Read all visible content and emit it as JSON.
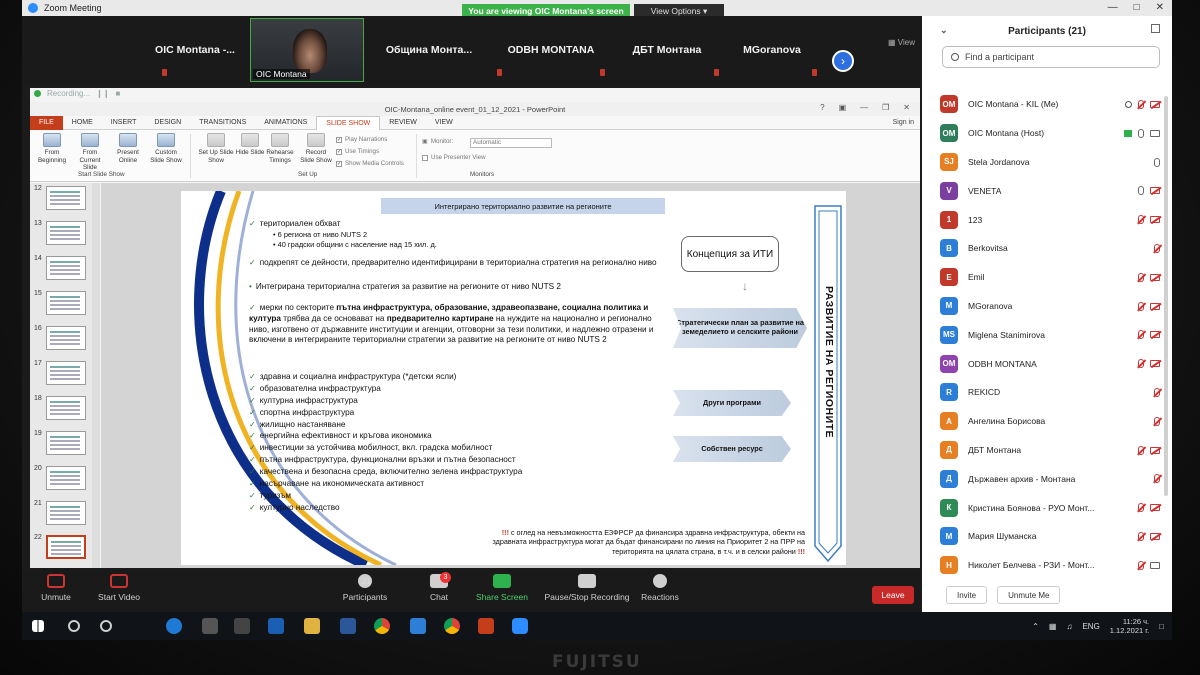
{
  "zoom": {
    "window_title": "Zoom Meeting",
    "viewing_banner": "You are viewing OIC Montana's screen",
    "view_options": "View Options",
    "gallery_view_label": "View",
    "gallery_tiles": [
      "OIC Montana -...",
      "OIC Montana",
      "Община  Монта...",
      "ODBH MONTANA",
      "ДБТ Монтана",
      "MGoranova"
    ],
    "recording_label": "Recording..."
  },
  "ppt": {
    "window_title": "OIC-Montana_online event_01_12_2021 - PowerPoint",
    "tabs": [
      "FILE",
      "HOME",
      "INSERT",
      "DESIGN",
      "TRANSITIONS",
      "ANIMATIONS",
      "SLIDE SHOW",
      "REVIEW",
      "VIEW"
    ],
    "sign_in": "Sign in",
    "ribbon": {
      "from_beginning": "From Beginning",
      "from_current": "From Current Slide",
      "present_online": "Present Online",
      "custom_show": "Custom Slide Show",
      "group_start": "Start Slide Show",
      "set_up": "Set Up Slide Show",
      "hide_slide": "Hide Slide",
      "rehearse": "Rehearse Timings",
      "record": "Record Slide Show",
      "play_narrations": "Play Narrations",
      "use_timings": "Use Timings",
      "show_media": "Show Media Controls",
      "group_setup": "Set Up",
      "monitor_label": "Monitor:",
      "monitor_value": "Automatic",
      "presenter_view": "Use Presenter View",
      "group_monitors": "Monitors"
    },
    "thumbnails": [
      "12",
      "13",
      "14",
      "15",
      "16",
      "17",
      "18",
      "19",
      "20",
      "21",
      "22"
    ]
  },
  "slide": {
    "title": "Интегрирано териториално развитие на регионите",
    "b1": "териториален обхват",
    "b1_sub1": "6 региона от ниво NUTS 2",
    "b1_sub2": "40 градски общини с население над 15 хил. д.",
    "b2": "подкрепят се дейности, предварително идентифицирани в териториална стратегия на регионално ниво",
    "b3": "Интегрирана териториална стратегия за развитие на регионите от ниво NUTS 2",
    "b4_pre": "мерки по секторите ",
    "b4_bold": "пътна инфраструктура, образование, здравеопазване, социална политика и култура",
    "b4_mid": " трябва да се основават на ",
    "b4_bold2": "предварително картиране",
    "b4_post": " на нуждите на национално и регионално ниво, изготвено от държавните институции и агенции, отговорни за тези политики, и надлежно отразени и включени в интегрираните териториални стратегии за развитие на регионите от ниво NUTS 2",
    "list": [
      "здравна и социална инфраструктура (*детски ясли)",
      "образователна инфраструктура",
      "културна инфраструктура",
      "спортна инфраструктура",
      "жилищно настаняване",
      "енергийна ефективност и кръгова икономика",
      "инвестиции за устойчива мобилност, вкл. градска мобилност",
      "пътна инфраструктура, функционални връзки и пътна безопасност",
      "качествена и безопасна среда, включително зелена инфраструктура",
      "насърчаване на икономическата активност",
      "туризъм",
      "културно наследство"
    ],
    "concept": "Концепция за ИТИ",
    "pill1": "Стратегически план за развитие на земеделието и селските райони",
    "pill2": "Други програми",
    "pill3": "Собствен ресурс",
    "vertical": "РАЗВИТИЕ НА РЕГИОНИТЕ",
    "note_marks": "!!!",
    "note_text": "с оглед на невъзможността ЕЗФРСР да финансира здравна инфраструктура, обекти на здравната инфраструктура могат да бъдат финансирани по линия на Приоритет 2 на ПРР на територията на цялата страна, в т.ч. и в селски райони",
    "note_end": "!!!"
  },
  "toolbar": {
    "unmute": "Unmute",
    "start_video": "Start Video",
    "participants": "Participants",
    "participants_count": "21",
    "chat": "Chat",
    "chat_badge": "3",
    "share_screen": "Share Screen",
    "pause_recording": "Pause/Stop Recording",
    "reactions": "Reactions",
    "leave": "Leave"
  },
  "panel": {
    "title": "Participants (21)",
    "search_placeholder": "Find a participant",
    "participants": [
      {
        "initials": "OM",
        "name": "OIC Montana - KIL (Me)",
        "color": "#c0392b"
      },
      {
        "initials": "OM",
        "name": "OIC Montana (Host)",
        "color": "#2e7d5b"
      },
      {
        "initials": "SJ",
        "name": "Stela Jordanova",
        "color": "#e67e22"
      },
      {
        "initials": "V",
        "name": "VENETA",
        "color": "#7b3fa0"
      },
      {
        "initials": "1",
        "name": "123",
        "color": "#c0392b"
      },
      {
        "initials": "B",
        "name": "Berkovitsa",
        "color": "#2d7ed6"
      },
      {
        "initials": "E",
        "name": "Emil",
        "color": "#c0392b"
      },
      {
        "initials": "M",
        "name": "MGoranova",
        "color": "#2d7ed6"
      },
      {
        "initials": "MS",
        "name": "Miglena Stanimirova",
        "color": "#2d7ed6"
      },
      {
        "initials": "OM",
        "name": "ODBH MONTANA",
        "color": "#8e44ad"
      },
      {
        "initials": "R",
        "name": "REKICD",
        "color": "#2d7ed6"
      },
      {
        "initials": "А",
        "name": "Ангелина Борисова",
        "color": "#e67e22"
      },
      {
        "initials": "Д",
        "name": "ДБТ Монтана",
        "color": "#e67e22"
      },
      {
        "initials": "Д",
        "name": "Държавен архив - Монтана",
        "color": "#2d7ed6"
      },
      {
        "initials": "К",
        "name": "Кристина Боянова - РУО Монт...",
        "color": "#2e8b57"
      },
      {
        "initials": "М",
        "name": "Мария Шуманска",
        "color": "#2d7ed6"
      },
      {
        "initials": "Н",
        "name": "Николет Белчева - РЗИ - Монт...",
        "color": "#e67e22"
      }
    ],
    "invite": "Invite",
    "unmute_me": "Unmute Me"
  },
  "taskbar": {
    "lang": "ENG",
    "time": "11:26 ч.",
    "date": "1.12.2021 г."
  },
  "brand": "FUJITSU"
}
